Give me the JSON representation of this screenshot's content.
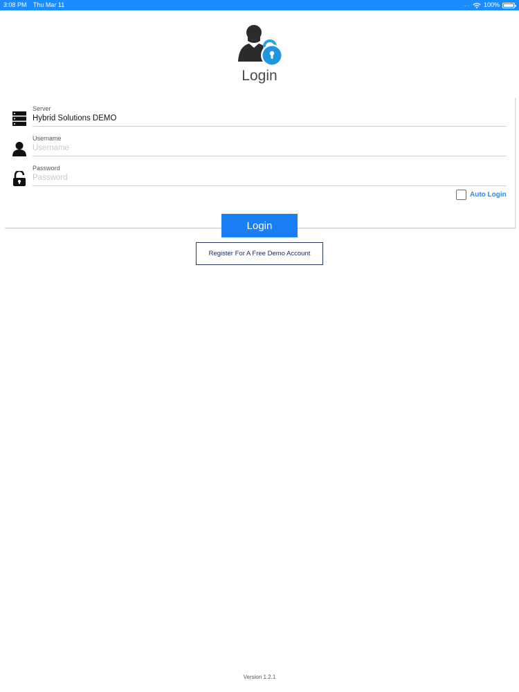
{
  "status_bar": {
    "time": "3:08 PM",
    "date": "Thu Mar 11",
    "signal": "....",
    "battery": "100%"
  },
  "header": {
    "title": "Login",
    "logo_icon": "user-lock-icon"
  },
  "form": {
    "server": {
      "label": "Server",
      "value": "Hybrid Solutions DEMO",
      "icon": "server-icon"
    },
    "username": {
      "label": "Username",
      "placeholder": "Username",
      "value": "",
      "icon": "user-icon"
    },
    "password": {
      "label": "Password",
      "placeholder": "Password",
      "value": "",
      "icon": "unlock-icon"
    },
    "auto_login": {
      "label": "Auto Login",
      "checked": false
    }
  },
  "actions": {
    "login_label": "Login",
    "register_label": "Register For A Free Demo Account"
  },
  "footer": {
    "version": "Version 1.2.1"
  },
  "colors": {
    "accent": "#1a8cff",
    "button": "#1a7ff5",
    "register_border": "#2c3560"
  }
}
